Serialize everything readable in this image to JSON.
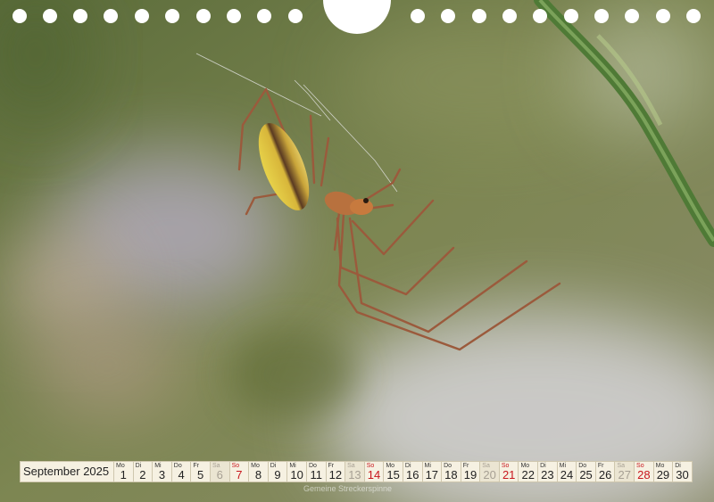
{
  "calendar": {
    "month_label": "September 2025",
    "days": [
      {
        "wd": "Mo",
        "num": "1",
        "type": "weekday"
      },
      {
        "wd": "Di",
        "num": "2",
        "type": "weekday"
      },
      {
        "wd": "Mi",
        "num": "3",
        "type": "weekday"
      },
      {
        "wd": "Do",
        "num": "4",
        "type": "weekday"
      },
      {
        "wd": "Fr",
        "num": "5",
        "type": "weekday"
      },
      {
        "wd": "Sa",
        "num": "6",
        "type": "sat"
      },
      {
        "wd": "So",
        "num": "7",
        "type": "sun"
      },
      {
        "wd": "Mo",
        "num": "8",
        "type": "weekday"
      },
      {
        "wd": "Di",
        "num": "9",
        "type": "weekday"
      },
      {
        "wd": "Mi",
        "num": "10",
        "type": "weekday"
      },
      {
        "wd": "Do",
        "num": "11",
        "type": "weekday"
      },
      {
        "wd": "Fr",
        "num": "12",
        "type": "weekday"
      },
      {
        "wd": "Sa",
        "num": "13",
        "type": "sat"
      },
      {
        "wd": "So",
        "num": "14",
        "type": "sun"
      },
      {
        "wd": "Mo",
        "num": "15",
        "type": "weekday"
      },
      {
        "wd": "Di",
        "num": "16",
        "type": "weekday"
      },
      {
        "wd": "Mi",
        "num": "17",
        "type": "weekday"
      },
      {
        "wd": "Do",
        "num": "18",
        "type": "weekday"
      },
      {
        "wd": "Fr",
        "num": "19",
        "type": "weekday"
      },
      {
        "wd": "Sa",
        "num": "20",
        "type": "sat"
      },
      {
        "wd": "So",
        "num": "21",
        "type": "sun"
      },
      {
        "wd": "Mo",
        "num": "22",
        "type": "weekday"
      },
      {
        "wd": "Di",
        "num": "23",
        "type": "weekday"
      },
      {
        "wd": "Mi",
        "num": "24",
        "type": "weekday"
      },
      {
        "wd": "Do",
        "num": "25",
        "type": "weekday"
      },
      {
        "wd": "Fr",
        "num": "26",
        "type": "weekday"
      },
      {
        "wd": "Sa",
        "num": "27",
        "type": "sat"
      },
      {
        "wd": "So",
        "num": "28",
        "type": "sun"
      },
      {
        "wd": "Mo",
        "num": "29",
        "type": "weekday"
      },
      {
        "wd": "Di",
        "num": "30",
        "type": "weekday"
      }
    ]
  },
  "caption": "Gemeine Streckerspinne",
  "colors": {
    "background": "#6f7a4a",
    "sunday": "#c8161d",
    "cell": "#f6f1e2"
  }
}
